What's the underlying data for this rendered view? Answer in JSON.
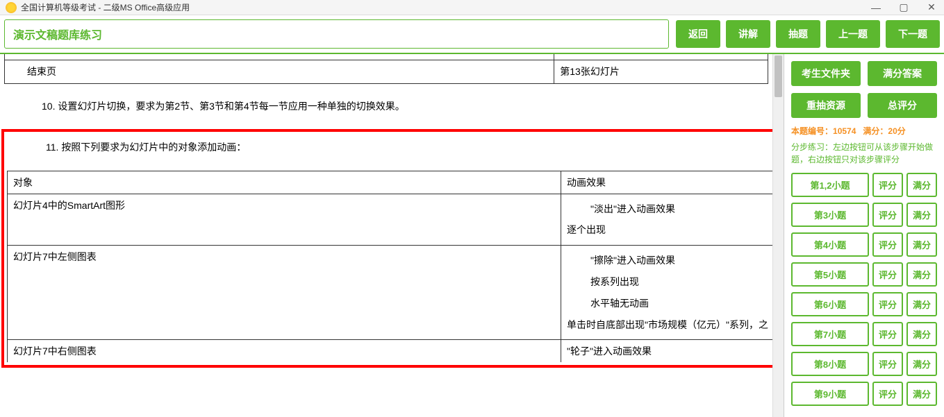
{
  "window": {
    "title": "全国计算机等级考试 - 二级MS Office高级应用"
  },
  "header": {
    "label": "演示文稿题库练习",
    "buttons": {
      "back": "返回",
      "explain": "讲解",
      "draw": "抽题",
      "prev": "上一题",
      "next": "下一题"
    }
  },
  "content": {
    "table1": {
      "r1c1": "结束页",
      "r1c2": "第13张幻灯片"
    },
    "q10": "10.   设置幻灯片切换，要求为第2节、第3节和第4节每一节应用一种单独的切换效果。",
    "q11": "11.   按照下列要求为幻灯片中的对象添加动画：",
    "table2": {
      "h1": "对象",
      "h2": "动画效果",
      "r1c1": "幻灯片4中的SmartArt图形",
      "r1c2a": "\"淡出\"进入动画效果",
      "r1c2b": "逐个出现",
      "r2c1": "幻灯片7中左侧图表",
      "r2c2a": "\"擦除\"进入动画效果",
      "r2c2b": "按系列出现",
      "r2c2c": "水平轴无动画",
      "r2c2d": "单击时自底部出现\"市场规模（亿元）\"系列，之",
      "r3c1": "幻灯片7中右侧图表",
      "r3c2": "\"轮子\"进入动画效果"
    }
  },
  "side": {
    "candidate_folder": "考生文件夹",
    "full_answer": "满分答案",
    "redraw": "重抽资源",
    "total_score": "总评分",
    "info_label": "本题编号：",
    "info_number": "10574",
    "score_label": "满分：",
    "score_value": "20分",
    "practice_text": "分步练习：左边按钮可从该步骤开始做题，右边按钮只对该步骤评分",
    "steps": [
      {
        "main": "第1,2小题",
        "score": "评分",
        "full": "满分"
      },
      {
        "main": "第3小题",
        "score": "评分",
        "full": "满分"
      },
      {
        "main": "第4小题",
        "score": "评分",
        "full": "满分"
      },
      {
        "main": "第5小题",
        "score": "评分",
        "full": "满分"
      },
      {
        "main": "第6小题",
        "score": "评分",
        "full": "满分"
      },
      {
        "main": "第7小题",
        "score": "评分",
        "full": "满分"
      },
      {
        "main": "第8小题",
        "score": "评分",
        "full": "满分"
      },
      {
        "main": "第9小题",
        "score": "评分",
        "full": "满分"
      }
    ]
  }
}
